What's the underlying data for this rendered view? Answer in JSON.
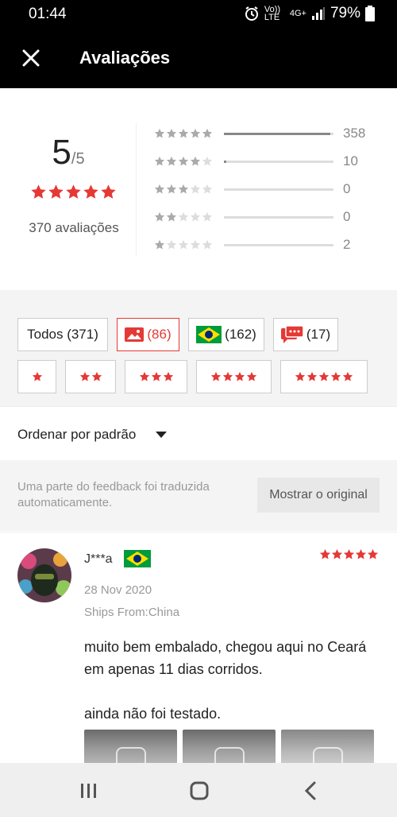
{
  "status_bar": {
    "time": "01:44",
    "network": "Vo)) LTE",
    "signal_label": "4G+",
    "battery": "79%"
  },
  "header": {
    "title": "Avaliações"
  },
  "summary": {
    "score": "5",
    "score_max": "/5",
    "stars": 5,
    "count_label": "370 avaliações",
    "distribution": [
      {
        "stars": 5,
        "count": "358",
        "fraction": 0.97
      },
      {
        "stars": 4,
        "count": "10",
        "fraction": 0.02
      },
      {
        "stars": 3,
        "count": "0",
        "fraction": 0
      },
      {
        "stars": 2,
        "count": "0",
        "fraction": 0
      },
      {
        "stars": 1,
        "count": "2",
        "fraction": 0
      }
    ]
  },
  "filters": {
    "all_label": "Todos (371)",
    "photos_count": "(86)",
    "country_count": "(162)",
    "comments_count": "(17)",
    "star_filters": [
      1,
      2,
      3,
      4,
      5
    ]
  },
  "sort": {
    "label": "Ordenar por padrão"
  },
  "notice": {
    "text": "Uma parte do feedback foi traduzida automaticamente.",
    "button": "Mostrar o original"
  },
  "review": {
    "name": "J***a",
    "rating": 5,
    "date": "28 Nov 2020",
    "ships_from": "Ships From:China",
    "body_line1": "muito bem embalado, chegou aqui no Ceará em apenas 11 dias corridos.",
    "body_line2": "ainda não foi testado."
  },
  "colors": {
    "accent": "#e53935",
    "star_gray": "#c8c8c8"
  }
}
